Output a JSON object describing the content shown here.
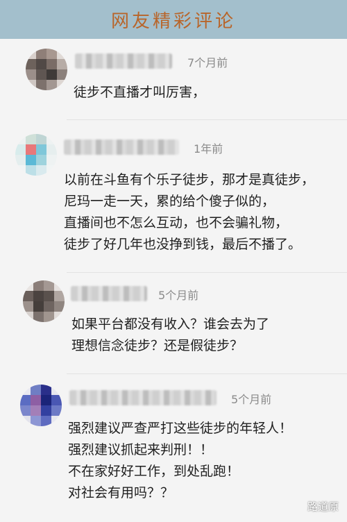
{
  "header": {
    "title": "网友精彩评论"
  },
  "comments": [
    {
      "time": "7个月前",
      "lines": [
        "徒步不直播才叫厉害，"
      ]
    },
    {
      "time": "1年前",
      "lines": [
        "以前在斗鱼有个乐子徒步，那才是真徒步，",
        "尼玛一走一天，累的给个傻子似的，",
        "直播间也不怎么互动，也不会骗礼物，",
        "徒步了好几年也没挣到钱，最后不播了。"
      ]
    },
    {
      "time": "5个月前",
      "lines": [
        "如果平台都没有收入？谁会去为了",
        "理想信念徒步？还是假徒步？"
      ]
    },
    {
      "time": "5个月前",
      "lines": [
        "强烈建议严查严打这些徒步的年轻人！",
        "强烈建议抓起来判刑！！",
        "不在家好好工作，到处乱跑！",
        "对社会有用吗？？"
      ]
    }
  ],
  "watermark": "路道原",
  "colors": {
    "header_bg": "#a3bfcc",
    "header_text": "#b8652a",
    "page_bg": "#f4f4f4"
  }
}
